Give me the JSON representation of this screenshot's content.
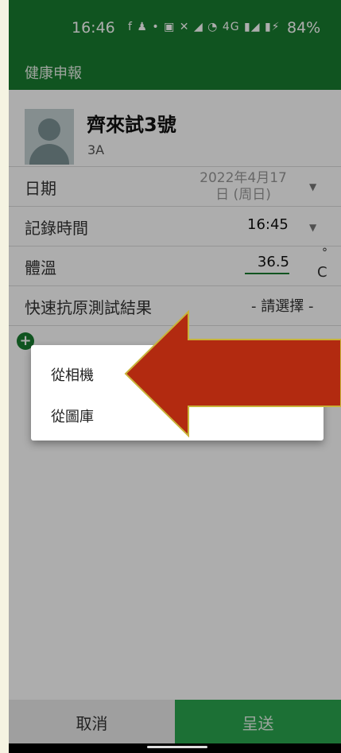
{
  "status_bar": {
    "time": "16:46",
    "icons": "f ♟ • ▣ ✕ ◢ ◔ 4G ▮◢ ▮⚡",
    "battery": "84%"
  },
  "app": {
    "title": "健康申報"
  },
  "student": {
    "name": "齊來試3號",
    "class": "3A"
  },
  "form": {
    "date": {
      "label": "日期",
      "value_line1": "2022年4月17",
      "value_line2": "日 (周日)"
    },
    "time": {
      "label": "記錄時間",
      "value": "16:45"
    },
    "temperature": {
      "label": "體溫",
      "value": "36.5",
      "unit_degree": "°",
      "unit_c": "C"
    },
    "rat_result": {
      "label": "快速抗原測試結果",
      "placeholder": "- 請選擇 -"
    },
    "add_photo_icon": "plus-circle-icon"
  },
  "menu": {
    "items": [
      {
        "label": "從相機"
      },
      {
        "label": "從圖庫"
      }
    ]
  },
  "buttons": {
    "cancel": "取消",
    "submit": "呈送"
  },
  "annotation": {
    "arrow_color": "#b22a10",
    "arrow_outline": "#c8b33a"
  },
  "colors": {
    "primary": "#197d30",
    "submit": "#2aa64e"
  }
}
